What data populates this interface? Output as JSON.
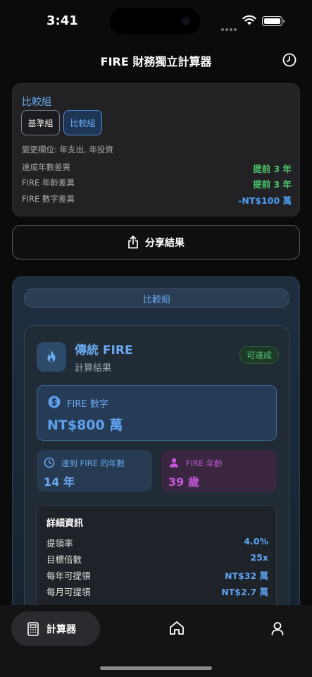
{
  "status_bar": {
    "time": "3:41"
  },
  "header": {
    "title": "FIRE 財務獨立計算器"
  },
  "comparison": {
    "title": "比較組",
    "segments": {
      "base": "基準組",
      "compare": "比較組"
    },
    "changed_fields": "變更欄位: 年支出, 年投資",
    "diffs": [
      {
        "label": "達成年數差異",
        "value": "提前 3 年"
      },
      {
        "label": "FIRE 年齡差異",
        "value": "提前 3 年"
      },
      {
        "label": "FIRE 數字差異",
        "value": "-NT$100 萬"
      }
    ]
  },
  "share": {
    "label": "分享結果"
  },
  "result": {
    "group_label": "比較組",
    "title": "傳統 FIRE",
    "subtitle": "計算結果",
    "badge": "可達成",
    "fire_number": {
      "label": "FIRE 數字",
      "value": "NT$800 萬"
    },
    "years_to_fire": {
      "label": "達到 FIRE 的年數",
      "value": "14 年"
    },
    "fire_age": {
      "label": "FIRE 年齡",
      "value": "39 歲"
    },
    "details": {
      "title": "詳細資訊",
      "rows": [
        {
          "label": "提領率",
          "value": "4.0%"
        },
        {
          "label": "目標倍數",
          "value": "25x"
        },
        {
          "label": "每年可提領",
          "value": "NT$32 萬"
        },
        {
          "label": "每月可提領",
          "value": "NT$2.7 萬"
        }
      ]
    }
  },
  "nav": {
    "calculator": "計算器"
  },
  "colors": {
    "accent": "#4c9af0",
    "positive": "#4cc56a",
    "age": "#c258d6"
  }
}
